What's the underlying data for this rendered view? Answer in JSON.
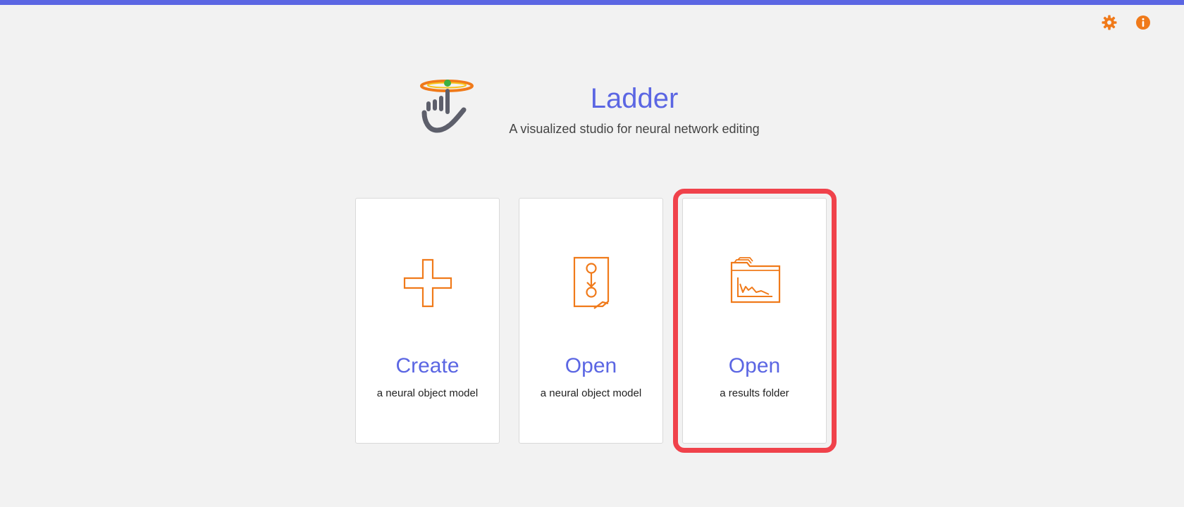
{
  "app": {
    "title": "Ladder",
    "subtitle": "A visualized studio for neural network editing"
  },
  "toolbar": {
    "settings_icon": "gear-icon",
    "info_icon": "info-icon"
  },
  "cards": [
    {
      "title": "Create",
      "subtitle": "a neural object model",
      "icon": "plus-icon"
    },
    {
      "title": "Open",
      "subtitle": "a neural object model",
      "icon": "model-document-icon"
    },
    {
      "title": "Open",
      "subtitle": "a results folder",
      "icon": "results-folder-icon"
    }
  ],
  "colors": {
    "accent": "#5b66e3",
    "icon_orange": "#f07a1a",
    "highlight": "#f0424b",
    "background": "#f2f2f2"
  }
}
